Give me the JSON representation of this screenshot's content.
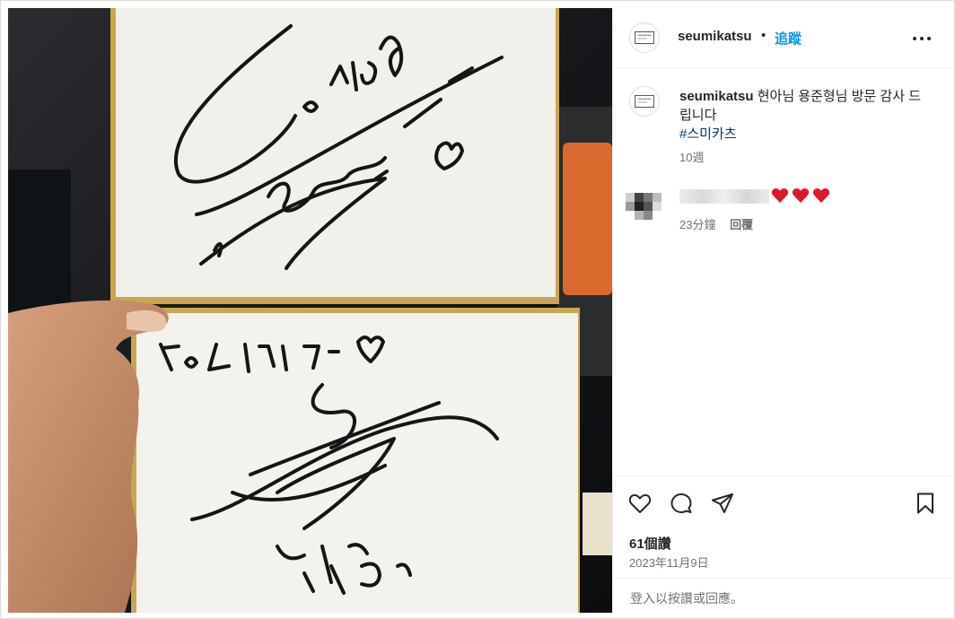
{
  "post": {
    "username": "seumikatsu",
    "dot": "•",
    "follow_label": "追蹤"
  },
  "caption": {
    "username": "seumikatsu",
    "text": "현아님 용준형님 방문 감사 드립니다",
    "hashtag": "#스미카츠",
    "time": "10週"
  },
  "comment": {
    "time": "23分鐘",
    "reply_label": "回覆",
    "hearts": 3
  },
  "stats": {
    "likes": "61個讚",
    "date": "2023年11月9日"
  },
  "login_prompt": "登入以按讚或回應。",
  "colors": {
    "accent": "#0095f6",
    "hashtag": "#00376b",
    "heart": "#e0162b",
    "muted": "#737373"
  },
  "icons": [
    "more-icon",
    "heart-icon",
    "comment-icon",
    "share-icon",
    "bookmark-icon"
  ]
}
